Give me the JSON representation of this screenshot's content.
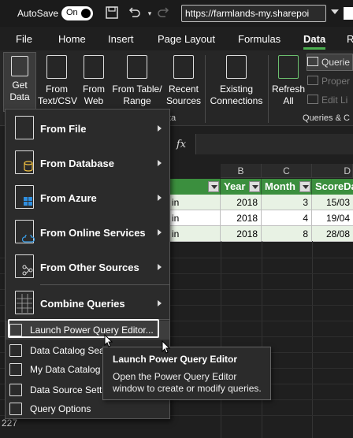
{
  "titlebar": {
    "autosave_label": "AutoSave",
    "toggle_state": "On",
    "url": "https://farmlands-my.sharepoi"
  },
  "tabs": [
    {
      "label": "File"
    },
    {
      "label": "Home"
    },
    {
      "label": "Insert"
    },
    {
      "label": "Page Layout"
    },
    {
      "label": "Formulas"
    },
    {
      "label": "Data"
    },
    {
      "label": "R"
    }
  ],
  "ribbon": {
    "get_data_line1": "Get",
    "get_data_line2": "Data",
    "from_text_1": "From",
    "from_text_2": "Text/CSV",
    "from_web_1": "From",
    "from_web_2": "Web",
    "from_table_1": "From Table/",
    "from_table_2": "Range",
    "recent_1": "Recent",
    "recent_2": "Sources",
    "existing_1": "Existing",
    "existing_2": "Connections",
    "refresh_1": "Refresh",
    "refresh_2": "All",
    "group_get_label": "ta",
    "queries_label": "Querie",
    "properties_label": "Proper",
    "editlinks_label": "Edit Li",
    "group_queries_label": "Queries & C"
  },
  "formula": {
    "fx": "fx"
  },
  "grid": {
    "columns": [
      "B",
      "C",
      "D"
    ],
    "headers": [
      "Year",
      "Month",
      "ScoreDa"
    ],
    "rows": [
      {
        "a": "in",
        "year": "2018",
        "month": "3",
        "date": "15/03"
      },
      {
        "a": "in",
        "year": "2018",
        "month": "4",
        "date": "19/04"
      },
      {
        "a": "in",
        "year": "2018",
        "month": "8",
        "date": "28/08"
      }
    ],
    "row_number": "227"
  },
  "menu": {
    "large_items": [
      {
        "label": "From File"
      },
      {
        "label": "From Database"
      },
      {
        "label": "From Azure"
      },
      {
        "label": "From Online Services"
      },
      {
        "label": "From Other Sources"
      },
      {
        "label": "Combine Queries"
      }
    ],
    "small_items": [
      {
        "label": "Launch Power Query Editor..."
      },
      {
        "label": "Data Catalog Sear"
      },
      {
        "label": "My Data Catalog Q"
      },
      {
        "label": "Data Source Setti"
      },
      {
        "label": "Query Options"
      }
    ]
  },
  "tooltip": {
    "title": "Launch Power Query Editor",
    "description": "Open the Power Query Editor window to create or modify queries."
  }
}
